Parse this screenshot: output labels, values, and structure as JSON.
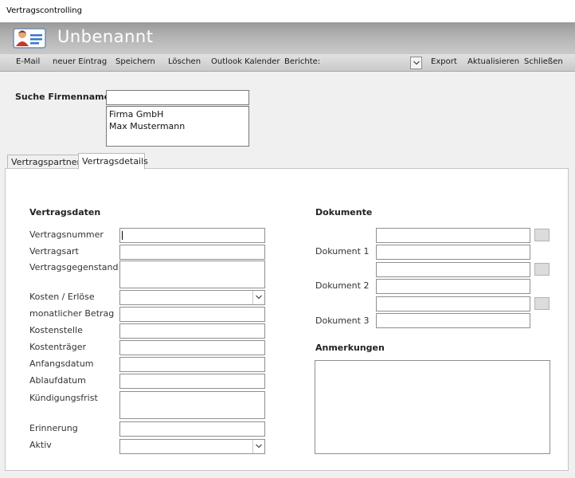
{
  "window": {
    "title": "Vertragscontrolling"
  },
  "header": {
    "form_title": "Unbenannt",
    "icon": "contact-card-icon"
  },
  "toolbar": {
    "email": "E-Mail",
    "new_entry": "neuer Eintrag",
    "save": "Speichern",
    "delete": "Löschen",
    "outlook": "Outlook Kalender",
    "reports": "Berichte:",
    "reports_selected": "",
    "export": "Export",
    "refresh": "Aktualisieren",
    "close": "Schließen"
  },
  "search": {
    "label": "Suche Firmennamen",
    "value": "",
    "results": [
      "Firma GmbH",
      "Max Mustermann"
    ]
  },
  "tabs": [
    {
      "label": "Vertragspartner",
      "active": false
    },
    {
      "label": "Vertragsdetails",
      "active": true
    }
  ],
  "contract": {
    "heading": "Vertragsdaten",
    "fields": {
      "number": {
        "label": "Vertragsnummer",
        "value": ""
      },
      "type": {
        "label": "Vertragsart",
        "value": ""
      },
      "subject": {
        "label": "Vertragsgegenstand",
        "value": ""
      },
      "cost_revenue": {
        "label": "Kosten / Erlöse",
        "value": ""
      },
      "monthly": {
        "label": "monatlicher Betrag",
        "value": ""
      },
      "cost_center": {
        "label": "Kostenstelle",
        "value": ""
      },
      "cost_unit": {
        "label": "Kostenträger",
        "value": ""
      },
      "start_date": {
        "label": "Anfangsdatum",
        "value": ""
      },
      "end_date": {
        "label": "Ablaufdatum",
        "value": ""
      },
      "notice": {
        "label": "Kündigungsfrist",
        "value": ""
      },
      "reminder": {
        "label": "Erinnerung",
        "value": ""
      },
      "active": {
        "label": "Aktiv",
        "value": ""
      }
    }
  },
  "documents": {
    "heading": "Dokumente",
    "items": [
      {
        "label": "Dokument 1",
        "path": "",
        "name": ""
      },
      {
        "label": "Dokument 2",
        "path": "",
        "name": ""
      },
      {
        "label": "Dokument 3",
        "path": "",
        "name": ""
      }
    ]
  },
  "notes": {
    "heading": "Anmerkungen",
    "value": ""
  }
}
